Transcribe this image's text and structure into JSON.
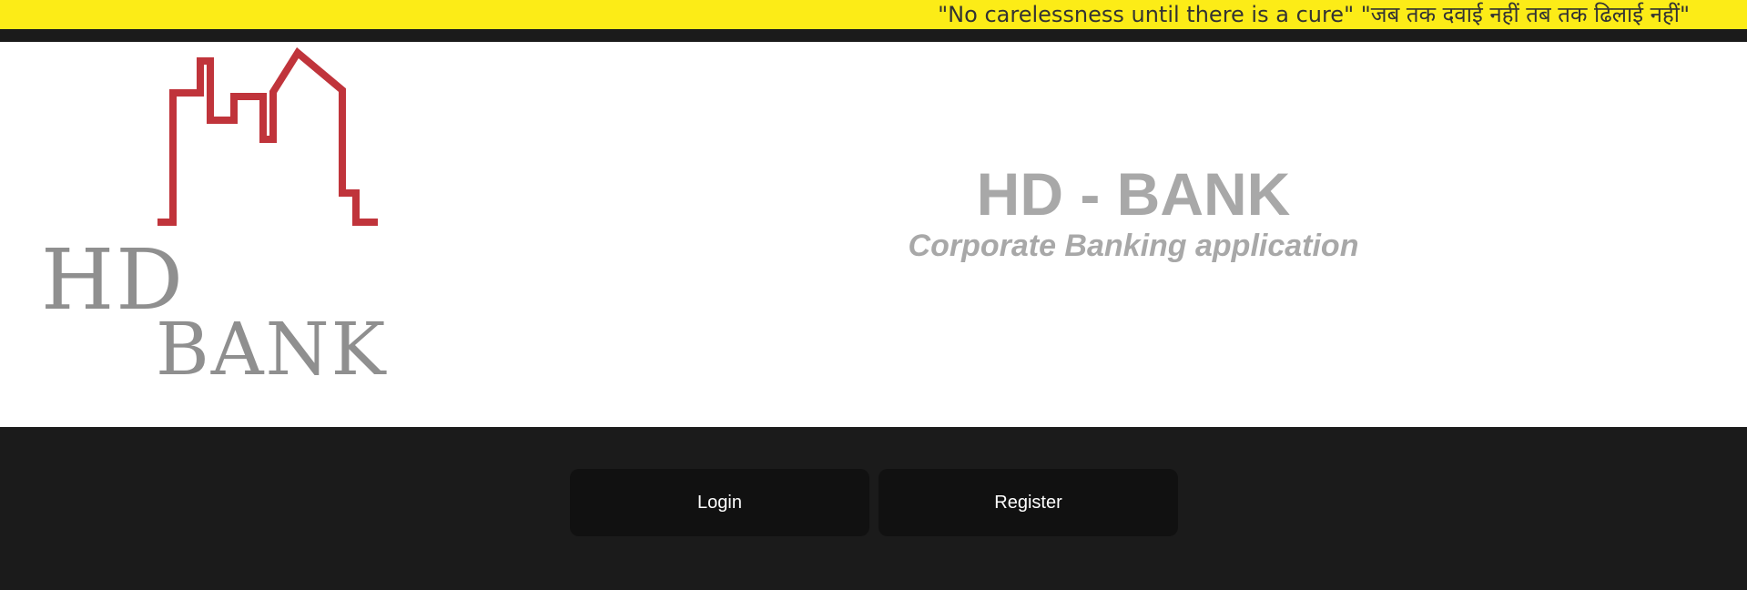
{
  "ticker": {
    "message": "\"No carelessness until there is a cure\" \"जब तक दवाई नहीं तब तक ढिलाई नहीं\""
  },
  "logo": {
    "word_top": "HD",
    "word_bottom": "BANK",
    "icon": "city-skyline-icon",
    "colors": {
      "skyline": "#c0343b",
      "wordmark": "#8f8f8f"
    }
  },
  "brand": {
    "title": "HD - BANK",
    "subtitle": "Corporate Banking application"
  },
  "actions": {
    "login_label": "Login",
    "register_label": "Register"
  },
  "colors": {
    "ticker_background": "#fcec17",
    "page_background": "#1b1b1b",
    "header_background": "#ffffff",
    "button_background": "#111111"
  }
}
